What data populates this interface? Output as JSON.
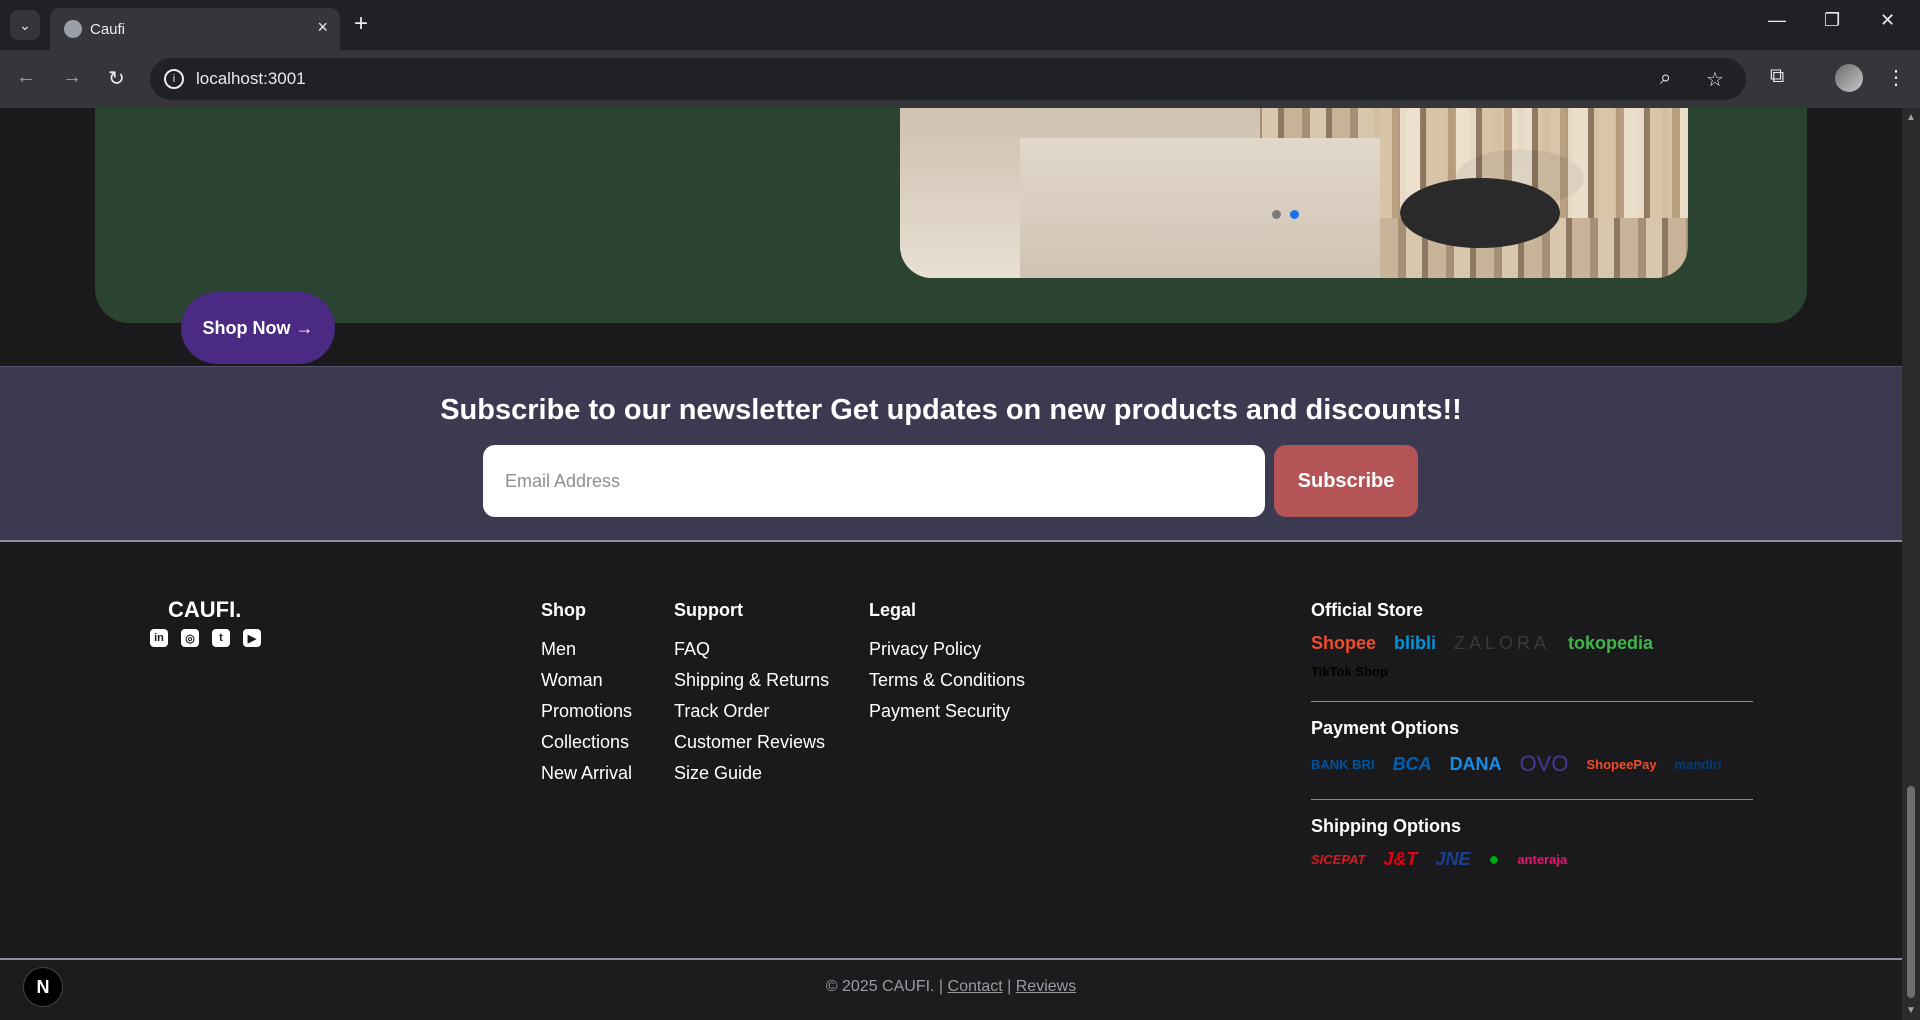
{
  "browser": {
    "tab_title": "Caufi",
    "url": "localhost:3001",
    "new_tab": "+",
    "minimize": "—",
    "restore": "❐",
    "close": "✕"
  },
  "hero": {
    "shop_now_label": "Shop Now →",
    "carousel_active_index": 1,
    "carousel_dots": 2,
    "colors": {
      "panel": "#2b4331",
      "button": "#4a2a82",
      "dot_active": "#1a73e8",
      "dot_inactive": "#7a7a7a"
    }
  },
  "newsletter": {
    "title": "Subscribe to our newsletter Get updates on new products and discounts!!",
    "email_placeholder": "Email Address",
    "email_value": "",
    "subscribe_label": "Subscribe",
    "colors": {
      "background": "#3c3a51",
      "button": "#b55457"
    }
  },
  "footer": {
    "brand": "CAUFI.",
    "socials": [
      {
        "icon": "linkedin-icon",
        "glyph": "in"
      },
      {
        "icon": "instagram-icon",
        "glyph": "◎"
      },
      {
        "icon": "twitter-icon",
        "glyph": "t"
      },
      {
        "icon": "youtube-icon",
        "glyph": "▶"
      }
    ],
    "columns": [
      {
        "title": "Shop",
        "links": [
          "Men",
          "Woman",
          "Promotions",
          "Collections",
          "New Arrival"
        ]
      },
      {
        "title": "Support",
        "links": [
          "FAQ",
          "Shipping & Returns",
          "Track Order",
          "Customer Reviews",
          "Size Guide"
        ]
      },
      {
        "title": "Legal",
        "links": [
          "Privacy Policy",
          "Terms & Conditions",
          "Payment Security"
        ]
      }
    ],
    "official_store": {
      "title": "Official Store",
      "logos": [
        {
          "name": "Shopee",
          "color": "#ee4d2d",
          "icon": "shopee-logo"
        },
        {
          "name": "blibli",
          "color": "#0095da",
          "icon": "blibli-logo"
        },
        {
          "name": "ZALORA",
          "color": "#3a3a3a",
          "icon": "zalora-logo"
        },
        {
          "name": "tokopedia",
          "color": "#42b549",
          "icon": "tokopedia-logo"
        },
        {
          "name": "TikTok Shop",
          "color": "#000000",
          "icon": "tiktok-shop-logo"
        }
      ]
    },
    "payment_options": {
      "title": "Payment Options",
      "logos": [
        {
          "name": "BANK BRI",
          "color": "#00529c",
          "icon": "bri-logo"
        },
        {
          "name": "BCA",
          "color": "#0060af",
          "icon": "bca-logo"
        },
        {
          "name": "DANA",
          "color": "#118ee9",
          "icon": "dana-logo"
        },
        {
          "name": "OVO",
          "color": "#4c3494",
          "icon": "ovo-logo"
        },
        {
          "name": "ShopeePay",
          "color": "#ee4d2d",
          "icon": "shopeepay-logo"
        },
        {
          "name": "mandiri",
          "color": "#003d79",
          "icon": "mandiri-logo"
        }
      ]
    },
    "shipping_options": {
      "title": "Shipping Options",
      "logos": [
        {
          "name": "SICEPAT",
          "color": "#d71920",
          "icon": "sicepat-logo"
        },
        {
          "name": "J&T",
          "color": "#e60012",
          "icon": "jnt-logo"
        },
        {
          "name": "JNE",
          "color": "#1a3f97",
          "icon": "jne-logo"
        },
        {
          "name": "●",
          "color": "#00aa13",
          "icon": "gosend-logo"
        },
        {
          "name": "anteraja",
          "color": "#e5176e",
          "icon": "anteraja-logo"
        }
      ]
    },
    "copyright_prefix": "© 2025 CAUFI. |",
    "contact_link": "Contact",
    "separator": "|",
    "reviews_link": "Reviews",
    "next_badge": "N"
  }
}
